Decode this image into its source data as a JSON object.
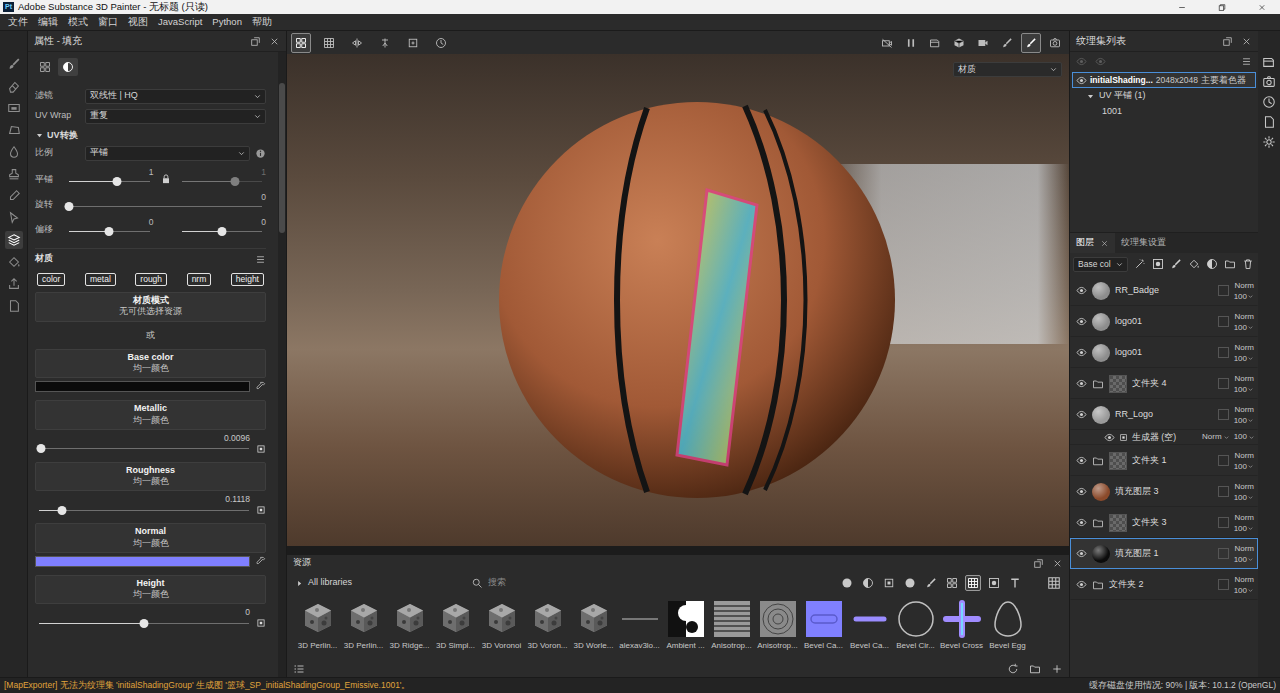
{
  "window": {
    "app_icon": "Pt",
    "title": "Adobe Substance 3D Painter - 无标题 (只读)"
  },
  "menu": [
    "文件",
    "编辑",
    "模式",
    "窗口",
    "视图",
    "JavaScript",
    "Python",
    "帮助"
  ],
  "toolstrip": [
    {
      "selected": false
    },
    {
      "selected": false
    },
    {
      "selected": false
    },
    {
      "selected": false
    },
    {
      "selected": false
    },
    {
      "selected": false
    },
    {
      "selected": false
    },
    {
      "selected": false
    },
    {
      "selected": true
    },
    {
      "selected": false
    },
    {
      "selected": false
    },
    {
      "selected": false
    }
  ],
  "properties": {
    "title": "属性 - 填充",
    "tabs": [
      {
        "selected": false
      },
      {
        "selected": true
      }
    ],
    "filter": {
      "label": "滤镜",
      "value": "双线性 | HQ"
    },
    "uv_wrap": {
      "label": "UV Wrap",
      "value": "重复"
    },
    "uv_transform": {
      "title": "UV转换",
      "expanded": true,
      "scale": {
        "label": "比例",
        "value": "平铺"
      },
      "tiling": {
        "label": "平铺",
        "locked": true,
        "left": {
          "value": "1",
          "level": 0.6,
          "disabled": false
        },
        "right": {
          "value": "1",
          "level": 0.66,
          "disabled": true
        }
      },
      "rotation": {
        "label": "旋转",
        "value": "0",
        "level": 0
      },
      "offset": {
        "label": "偏移",
        "left": {
          "value": "0",
          "level": 0.5
        },
        "right": {
          "value": "0",
          "level": 0.5
        }
      }
    },
    "material": {
      "title": "材质",
      "channels": [
        {
          "label": "color",
          "on": true
        },
        {
          "label": "metal",
          "on": true
        },
        {
          "label": "rough",
          "on": true
        },
        {
          "label": "nrm",
          "on": true
        },
        {
          "label": "height",
          "on": true
        }
      ],
      "mode": {
        "title": "材质模式",
        "value": "无可供选择资源"
      },
      "or": "或",
      "params": [
        {
          "kind": "swatch",
          "title": "Base color",
          "source": "均一颜色",
          "color": "#0b0b0b"
        },
        {
          "kind": "slider",
          "title": "Metallic",
          "source": "均一颜色",
          "reading": "0.0096",
          "level": 0.0096
        },
        {
          "kind": "slider",
          "title": "Roughness",
          "source": "均一颜色",
          "reading": "0.1118",
          "level": 0.1118
        },
        {
          "kind": "swatch",
          "title": "Normal",
          "source": "均一颜色",
          "color": "#7f7fff"
        },
        {
          "kind": "slider",
          "title": "Height",
          "source": "均一颜色",
          "reading": "0",
          "level": 0.5
        }
      ]
    }
  },
  "viewport": {
    "left_tools": [
      {
        "selected": true
      },
      {
        "selected": false
      },
      {
        "selected": false
      },
      {
        "selected": false
      },
      {
        "selected": false
      },
      {
        "selected": false
      }
    ],
    "right_tools": [
      {
        "selected": false
      },
      {
        "selected": false
      },
      {
        "selected": false
      },
      {
        "selected": false
      },
      {
        "selected": false
      },
      {
        "selected": false
      },
      {
        "selected": true
      },
      {
        "selected": false
      }
    ],
    "mode": "材质"
  },
  "assets": {
    "title": "资源",
    "library": "All libraries",
    "search_placeholder": "搜索",
    "filters": [
      {
        "selected": false
      },
      {
        "selected": false
      },
      {
        "selected": false
      },
      {
        "selected": false
      },
      {
        "selected": false
      },
      {
        "selected": false
      },
      {
        "selected": true
      },
      {
        "selected": false
      },
      {
        "selected": false
      }
    ],
    "items": [
      {
        "label": "3D Perlin...",
        "kind": "noise"
      },
      {
        "label": "3D Perlin...",
        "kind": "noise"
      },
      {
        "label": "3D Ridge...",
        "kind": "noise"
      },
      {
        "label": "3D Simpl...",
        "kind": "noise"
      },
      {
        "label": "3D Voronoi",
        "kind": "noise"
      },
      {
        "label": "3D Voron...",
        "kind": "noise"
      },
      {
        "label": "3D Worle...",
        "kind": "noise"
      },
      {
        "label": "alexav3lo...",
        "kind": "line"
      },
      {
        "label": "Ambient ...",
        "kind": "ambient"
      },
      {
        "label": "Anisotrop...",
        "kind": "stripes"
      },
      {
        "label": "Anisotrop...",
        "kind": "swirl"
      },
      {
        "label": "Bevel Ca...",
        "kind": "normalsquare"
      },
      {
        "label": "Bevel Ca...",
        "kind": "normaldash"
      },
      {
        "label": "Bevel Cir...",
        "kind": "circle"
      },
      {
        "label": "Bevel Cross",
        "kind": "cross"
      },
      {
        "label": "Bevel Egg",
        "kind": "egg"
      }
    ]
  },
  "texture_sets": {
    "title": "纹理集列表",
    "sets": [
      {
        "name": "initialShading...",
        "size": "2048x2048",
        "shader": "主要着色器",
        "selected": true
      }
    ],
    "uv": {
      "label": "UV 平铺 (1)",
      "expanded": true
    },
    "tiles": [
      "1001"
    ]
  },
  "layers": {
    "tabs": [
      {
        "label": "图层",
        "selected": true
      },
      {
        "label": "纹理集设置",
        "selected": false
      }
    ],
    "channel": "Base col",
    "items": [
      {
        "kind": "layer",
        "name": "RR_Badge",
        "visible": true,
        "selected": false,
        "mask": false,
        "blend": "Norm",
        "opacity": "100",
        "color": "#8d8d8d"
      },
      {
        "kind": "layer",
        "name": "logo01",
        "visible": true,
        "selected": false,
        "mask": false,
        "blend": "Norm",
        "opacity": "100",
        "color": "#8d8d8d"
      },
      {
        "kind": "layer",
        "name": "logo01",
        "visible": true,
        "selected": false,
        "mask": false,
        "blend": "Norm",
        "opacity": "100",
        "color": "#8d8d8d"
      },
      {
        "kind": "folder",
        "name": "文件夹 4",
        "visible": true,
        "selected": false,
        "mask": true,
        "blend": "Norm",
        "opacity": "100"
      },
      {
        "kind": "layer",
        "name": "RR_Logo",
        "visible": true,
        "selected": false,
        "mask": false,
        "blend": "Norm",
        "opacity": "100",
        "color": "#9a9a9a"
      },
      {
        "kind": "effect",
        "name": "生成器 (空)",
        "visible": true,
        "selected": false,
        "blend": "Norm",
        "opacity": "100"
      },
      {
        "kind": "folder",
        "name": "文件夹 1",
        "visible": true,
        "selected": false,
        "mask": true,
        "blend": "Norm",
        "opacity": "100"
      },
      {
        "kind": "layer",
        "name": "填充图层 3",
        "visible": true,
        "selected": false,
        "mask": false,
        "blend": "Norm",
        "opacity": "100",
        "color": "#8b4a2b"
      },
      {
        "kind": "folder",
        "name": "文件夹 3",
        "visible": true,
        "selected": false,
        "mask": true,
        "blend": "Norm",
        "opacity": "100"
      },
      {
        "kind": "layer",
        "name": "填充图层 1",
        "visible": true,
        "selected": true,
        "mask": false,
        "blend": "Norm",
        "opacity": "100",
        "color": "#0c0c0c"
      },
      {
        "kind": "folder",
        "name": "文件夹 2",
        "visible": true,
        "selected": false,
        "mask": false,
        "blend": "Norm",
        "opacity": "100"
      }
    ]
  },
  "status": {
    "message": "[MapExporter] 无法为纹理集 'initialShadingGroup' 生成图 '篮球_SP_initialShadingGroup_Emissive.1001'。",
    "info": "缓存磁盘使用情况: 90% | 版本: 10.1.2 (OpenGL)"
  }
}
